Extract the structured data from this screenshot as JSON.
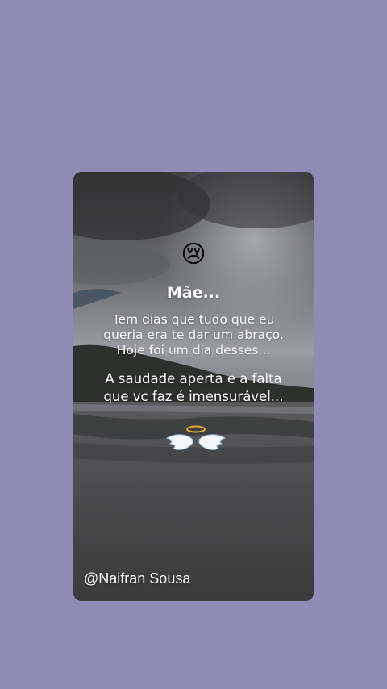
{
  "background_color": "#8f8bb5",
  "card": {
    "emoji": "😢",
    "emoji_icon": "crying-face-icon",
    "title": "Mãe...",
    "lines_1": [
      "Tem dias que tudo que eu",
      "queria era te dar um abraço.",
      "Hoje foi um dia desses..."
    ],
    "lines_2": [
      "A saudade aperta e a falta",
      "que vc faz é imensurável..."
    ],
    "angel_icon": "angel-wings-halo-icon",
    "username": "@Naifran Sousa"
  }
}
